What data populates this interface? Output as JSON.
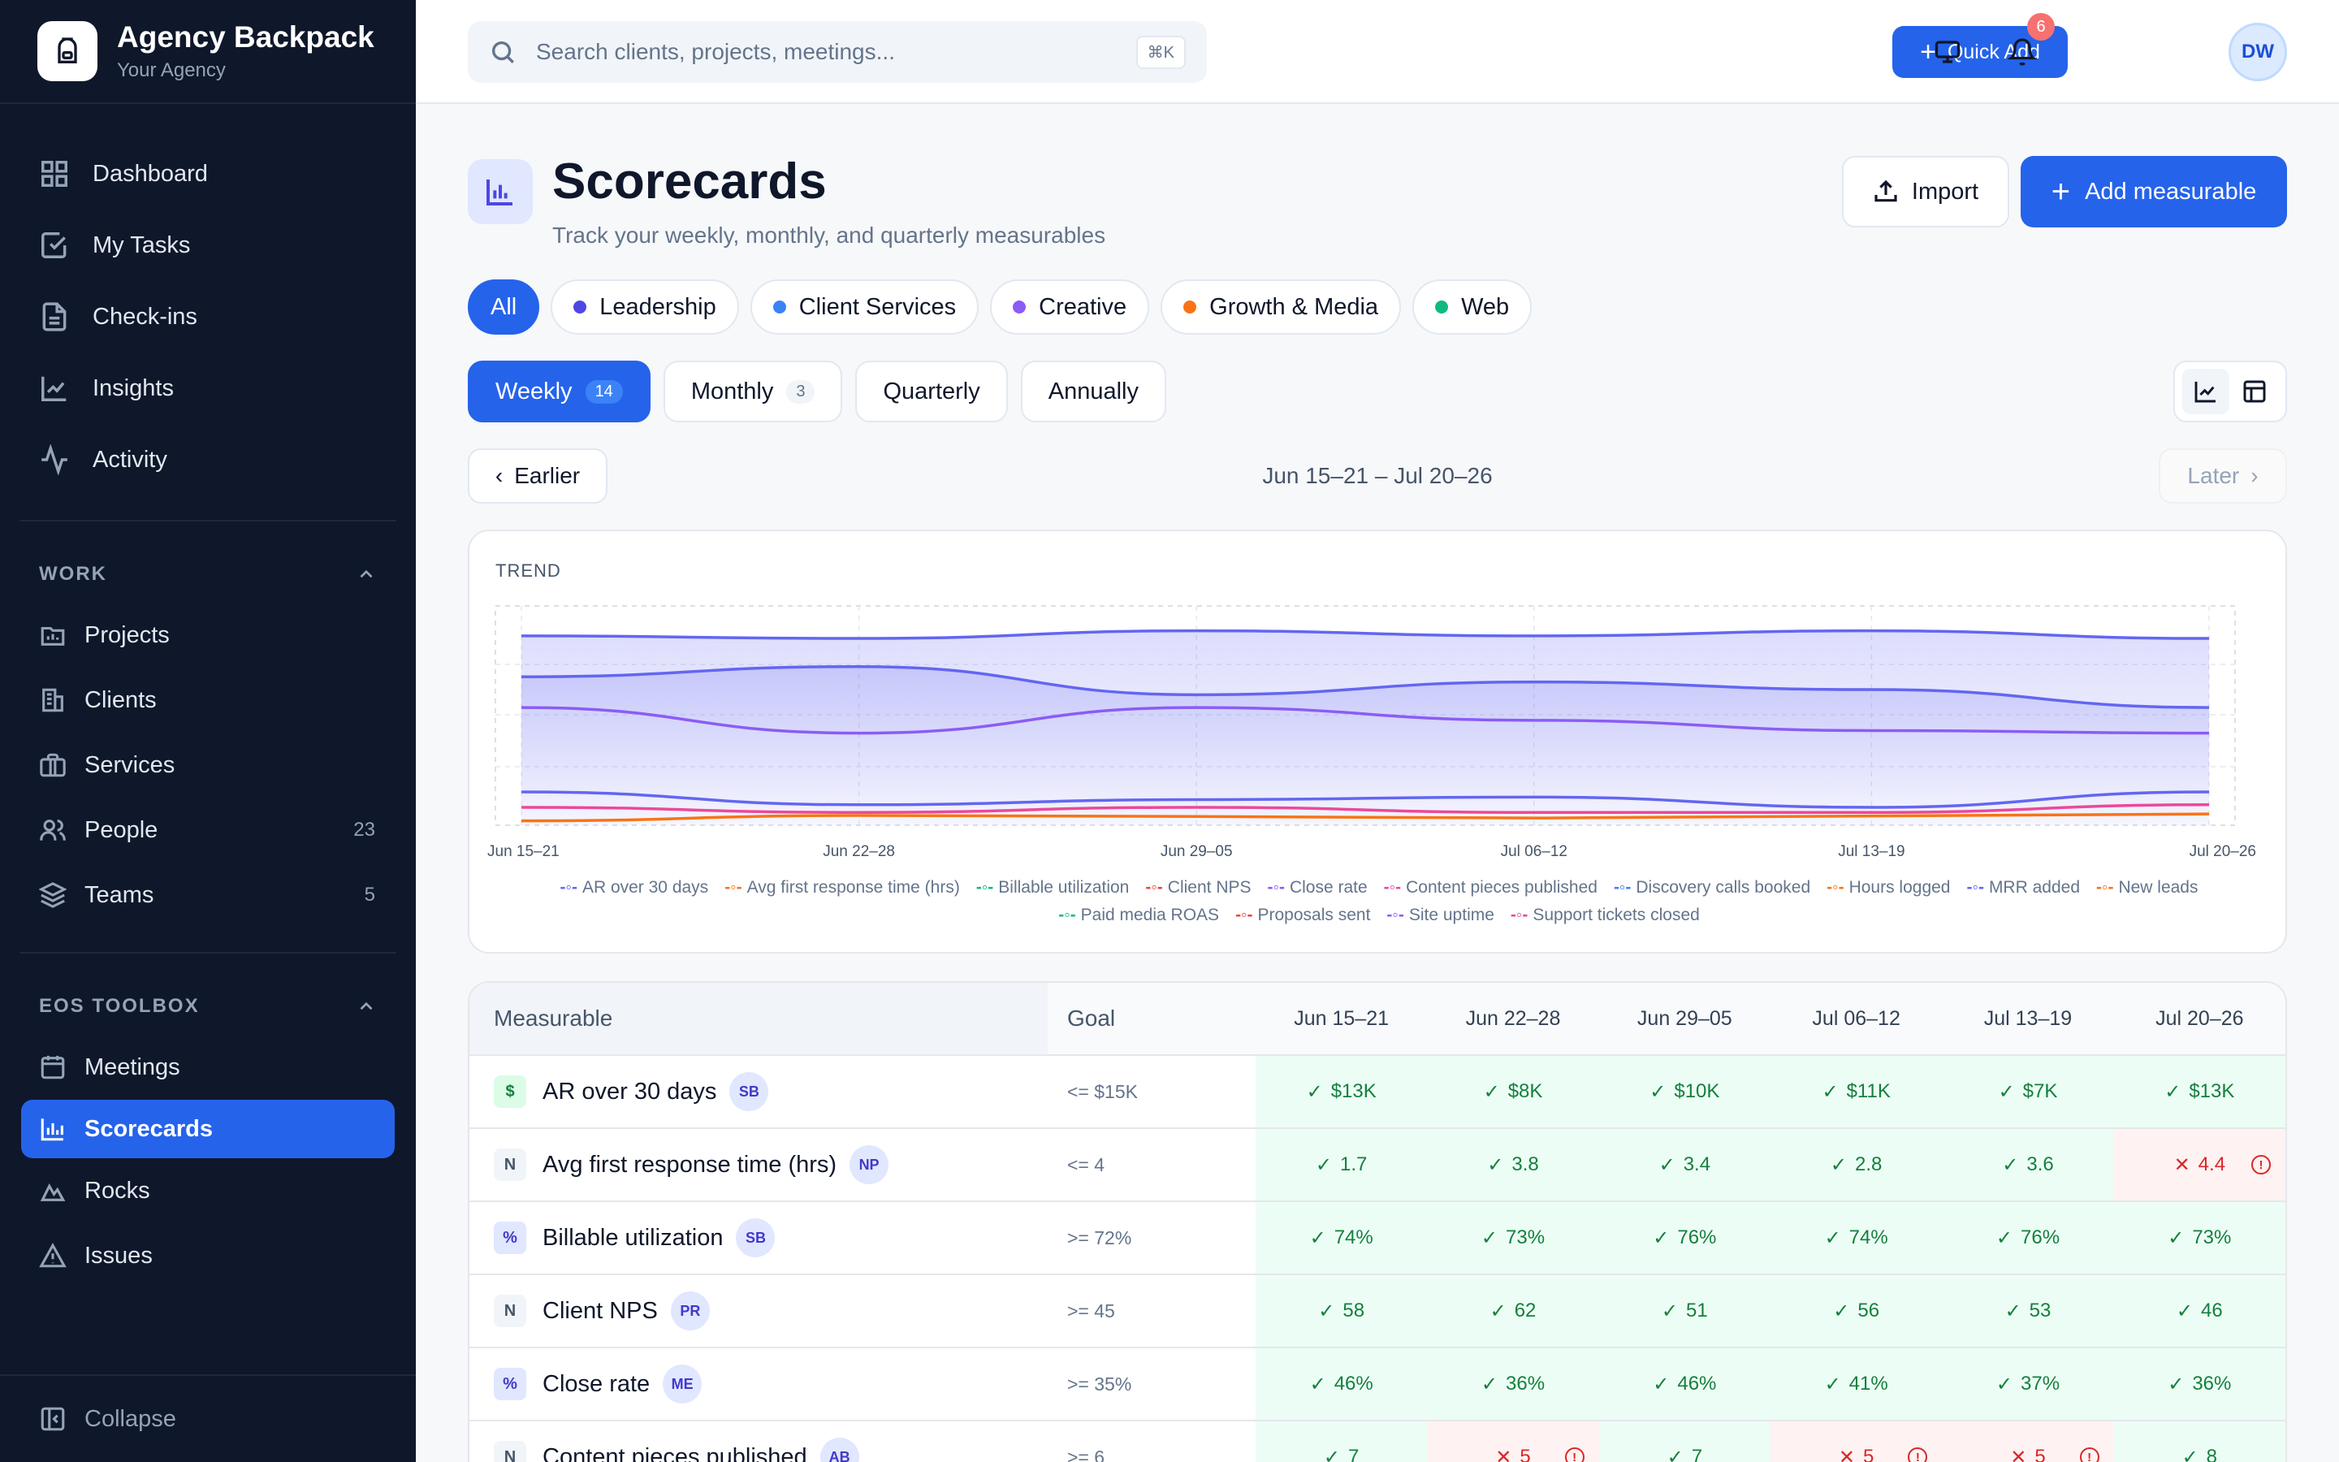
{
  "brand": {
    "name": "Agency Backpack",
    "subtitle": "Your Agency"
  },
  "nav_main": [
    {
      "label": "Dashboard",
      "icon": "grid-icon"
    },
    {
      "label": "My Tasks",
      "icon": "check-square-icon"
    },
    {
      "label": "Check-ins",
      "icon": "document-icon"
    },
    {
      "label": "Insights",
      "icon": "line-chart-icon"
    },
    {
      "label": "Activity",
      "icon": "activity-icon"
    }
  ],
  "work": {
    "title": "WORK",
    "items": [
      {
        "label": "Projects",
        "count": ""
      },
      {
        "label": "Clients",
        "count": ""
      },
      {
        "label": "Services",
        "count": ""
      },
      {
        "label": "People",
        "count": "23"
      },
      {
        "label": "Teams",
        "count": "5"
      }
    ]
  },
  "eos": {
    "title": "EOS TOOLBOX",
    "items": [
      {
        "label": "Meetings"
      },
      {
        "label": "Scorecards"
      },
      {
        "label": "Rocks"
      },
      {
        "label": "Issues"
      }
    ]
  },
  "collapse_label": "Collapse",
  "topbar": {
    "search_placeholder": "Search clients, projects, meetings...",
    "shortcut": "⌘K",
    "quick_add": "Quick Add",
    "notif_count": "6",
    "avatar_initials": "DW"
  },
  "page": {
    "title": "Scorecards",
    "subtitle": "Track your weekly, monthly, and quarterly measurables",
    "import_label": "Import",
    "add_label": "Add measurable"
  },
  "teams": [
    {
      "label": "All",
      "color": ""
    },
    {
      "label": "Leadership",
      "color": "#4f46e5"
    },
    {
      "label": "Client Services",
      "color": "#3b82f6"
    },
    {
      "label": "Creative",
      "color": "#8b5cf6"
    },
    {
      "label": "Growth & Media",
      "color": "#f97316"
    },
    {
      "label": "Web",
      "color": "#10b981"
    }
  ],
  "periods": [
    {
      "label": "Weekly",
      "count": "14"
    },
    {
      "label": "Monthly",
      "count": "3"
    },
    {
      "label": "Quarterly",
      "count": ""
    },
    {
      "label": "Annually",
      "count": ""
    }
  ],
  "range_nav": {
    "earlier": "Earlier",
    "range": "Jun 15–21 – Jul 20–26",
    "later": "Later"
  },
  "trend": {
    "title": "TREND",
    "x_labels": [
      "Jun 15–21",
      "Jun 22–28",
      "Jun 29–05",
      "Jul 06–12",
      "Jul 13–19",
      "Jul 20–26"
    ],
    "legend": [
      {
        "label": "AR over 30 days",
        "color": "#6366f1"
      },
      {
        "label": "Avg first response time (hrs)",
        "color": "#f97316"
      },
      {
        "label": "Billable utilization",
        "color": "#10b981"
      },
      {
        "label": "Client NPS",
        "color": "#ef4444"
      },
      {
        "label": "Close rate",
        "color": "#8b5cf6"
      },
      {
        "label": "Content pieces published",
        "color": "#ec4899"
      },
      {
        "label": "Discovery calls booked",
        "color": "#3b82f6"
      },
      {
        "label": "Hours logged",
        "color": "#f97316"
      },
      {
        "label": "MRR added",
        "color": "#6366f1"
      },
      {
        "label": "New leads",
        "color": "#f97316"
      },
      {
        "label": "Paid media ROAS",
        "color": "#10b981"
      },
      {
        "label": "Proposals sent",
        "color": "#ef4444"
      },
      {
        "label": "Site uptime",
        "color": "#8b5cf6"
      },
      {
        "label": "Support tickets closed",
        "color": "#ec4899"
      }
    ]
  },
  "chart_data": {
    "type": "area",
    "x": [
      "Jun 15–21",
      "Jun 22–28",
      "Jun 29–05",
      "Jul 06–12",
      "Jul 13–19",
      "Jul 20–26"
    ],
    "series": [
      {
        "name": "AR over 30 days",
        "values": [
          13,
          8,
          10,
          11,
          7,
          13
        ]
      },
      {
        "name": "Avg first response time (hrs)",
        "values": [
          1.7,
          3.8,
          3.4,
          2.8,
          3.6,
          4.4
        ]
      },
      {
        "name": "Billable utilization",
        "values": [
          74,
          73,
          76,
          74,
          76,
          73
        ]
      },
      {
        "name": "Client NPS",
        "values": [
          58,
          62,
          51,
          56,
          53,
          46
        ]
      },
      {
        "name": "Close rate",
        "values": [
          46,
          36,
          46,
          41,
          37,
          36
        ]
      },
      {
        "name": "Content pieces published",
        "values": [
          7,
          5,
          7,
          5,
          5,
          8
        ]
      }
    ]
  },
  "table": {
    "headers": {
      "measurable": "Measurable",
      "goal": "Goal"
    },
    "weeks": [
      "Jun 15–21",
      "Jun 22–28",
      "Jun 29–05",
      "Jul 06–12",
      "Jul 13–19",
      "Jul 20–26"
    ],
    "rows": [
      {
        "type": "$",
        "name": "AR over 30 days",
        "owner": "SB",
        "goal": "<= $15K",
        "cells": [
          {
            "v": "$13K",
            "s": "ok"
          },
          {
            "v": "$8K",
            "s": "ok"
          },
          {
            "v": "$10K",
            "s": "ok"
          },
          {
            "v": "$11K",
            "s": "ok"
          },
          {
            "v": "$7K",
            "s": "ok"
          },
          {
            "v": "$13K",
            "s": "ok"
          }
        ]
      },
      {
        "type": "N",
        "name": "Avg first response time (hrs)",
        "owner": "NP",
        "goal": "<= 4",
        "cells": [
          {
            "v": "1.7",
            "s": "ok"
          },
          {
            "v": "3.8",
            "s": "ok"
          },
          {
            "v": "3.4",
            "s": "ok"
          },
          {
            "v": "2.8",
            "s": "ok"
          },
          {
            "v": "3.6",
            "s": "ok"
          },
          {
            "v": "4.4",
            "s": "bad"
          }
        ]
      },
      {
        "type": "%",
        "name": "Billable utilization",
        "owner": "SB",
        "goal": ">= 72%",
        "cells": [
          {
            "v": "74%",
            "s": "ok"
          },
          {
            "v": "73%",
            "s": "ok"
          },
          {
            "v": "76%",
            "s": "ok"
          },
          {
            "v": "74%",
            "s": "ok"
          },
          {
            "v": "76%",
            "s": "ok"
          },
          {
            "v": "73%",
            "s": "ok"
          }
        ]
      },
      {
        "type": "N",
        "name": "Client NPS",
        "owner": "PR",
        "goal": ">= 45",
        "cells": [
          {
            "v": "58",
            "s": "ok"
          },
          {
            "v": "62",
            "s": "ok"
          },
          {
            "v": "51",
            "s": "ok"
          },
          {
            "v": "56",
            "s": "ok"
          },
          {
            "v": "53",
            "s": "ok"
          },
          {
            "v": "46",
            "s": "ok"
          }
        ]
      },
      {
        "type": "%",
        "name": "Close rate",
        "owner": "ME",
        "goal": ">= 35%",
        "cells": [
          {
            "v": "46%",
            "s": "ok"
          },
          {
            "v": "36%",
            "s": "ok"
          },
          {
            "v": "46%",
            "s": "ok"
          },
          {
            "v": "41%",
            "s": "ok"
          },
          {
            "v": "37%",
            "s": "ok"
          },
          {
            "v": "36%",
            "s": "ok"
          }
        ]
      },
      {
        "type": "N",
        "name": "Content pieces published",
        "owner": "AB",
        "goal": ">= 6",
        "cells": [
          {
            "v": "7",
            "s": "ok"
          },
          {
            "v": "5",
            "s": "bad"
          },
          {
            "v": "7",
            "s": "ok"
          },
          {
            "v": "5",
            "s": "bad"
          },
          {
            "v": "5",
            "s": "bad"
          },
          {
            "v": "8",
            "s": "ok"
          }
        ]
      }
    ]
  }
}
